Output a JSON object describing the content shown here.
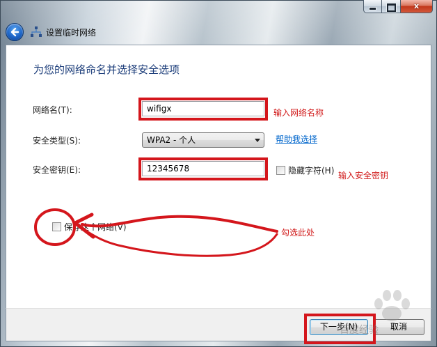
{
  "window": {
    "title": "设置临时网络",
    "caption": {
      "min": "",
      "max": "",
      "close": "x"
    }
  },
  "panel": {
    "heading": "为您的网络命名并选择安全选项"
  },
  "form": {
    "network_name_label": "网络名(T):",
    "network_name_value": "wifigx",
    "security_type_label": "安全类型(S):",
    "security_type_value": "WPA2 - 个人",
    "help_link": "帮助我选择",
    "security_key_label": "安全密钥(E):",
    "security_key_value": "12345678",
    "hide_chars_label": "隐藏字符(H)",
    "hide_chars_checked": false,
    "save_network_label": "保存这个网络(V)",
    "save_network_checked": false
  },
  "annotations": {
    "name_hint": "输入网络名称",
    "key_hint": "输入安全密钥",
    "check_hint": "勾选此处",
    "accent_color": "#d4161c"
  },
  "footer": {
    "next_label": "下一步(N)",
    "cancel_label": "取消"
  },
  "watermark": {
    "text": "百度经验"
  }
}
